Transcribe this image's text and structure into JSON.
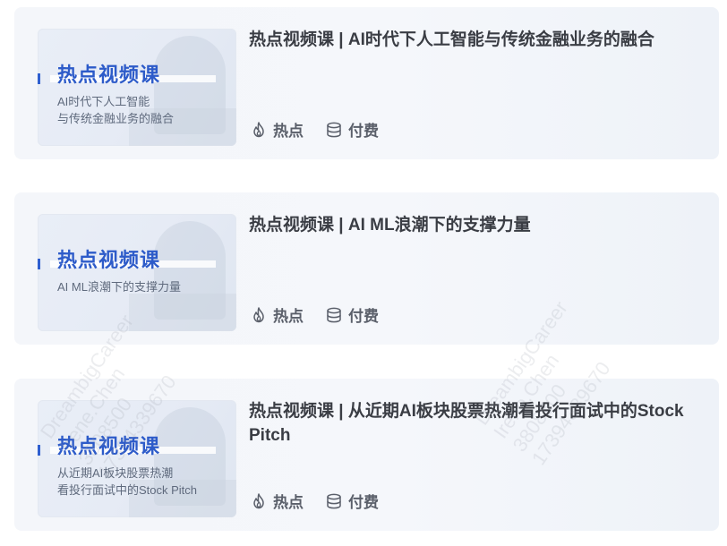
{
  "colors": {
    "accent": "#2d5bc9",
    "title_text": "#3a3d44",
    "tag_text": "#5a5f6a",
    "card_bg": "#f4f6fa"
  },
  "courses": [
    {
      "title": "热点视频课 | AI时代下人工智能与传统金融业务的融合",
      "thumb_title": "热点视频课",
      "thumb_subtitle": "AI时代下人工智能\n与传统金融业务的融合",
      "tags": [
        {
          "icon": "flame-icon",
          "label": "热点"
        },
        {
          "icon": "coins-icon",
          "label": "付费"
        }
      ]
    },
    {
      "title": "热点视频课 | AI ML浪潮下的支撑力量",
      "thumb_title": "热点视频课",
      "thumb_subtitle": "AI ML浪潮下的支撑力量",
      "tags": [
        {
          "icon": "flame-icon",
          "label": "热点"
        },
        {
          "icon": "coins-icon",
          "label": "付费"
        }
      ]
    },
    {
      "title": "热点视频课 | 从近期AI板块股票热潮看投行面试中的Stock Pitch",
      "thumb_title": "热点视频课",
      "thumb_subtitle": "从近期AI板块股票热潮\n看投行面试中的Stock Pitch",
      "tags": [
        {
          "icon": "flame-icon",
          "label": "热点"
        },
        {
          "icon": "coins-icon",
          "label": "付费"
        }
      ]
    }
  ],
  "watermarks": [
    {
      "lines": [
        "DreambigCareer",
        "Irene.Chen",
        "3808500",
        "17394339670"
      ]
    },
    {
      "lines": [
        "DreambigCareer",
        "Irene.Chen",
        "3808500",
        "17394339670"
      ]
    }
  ]
}
